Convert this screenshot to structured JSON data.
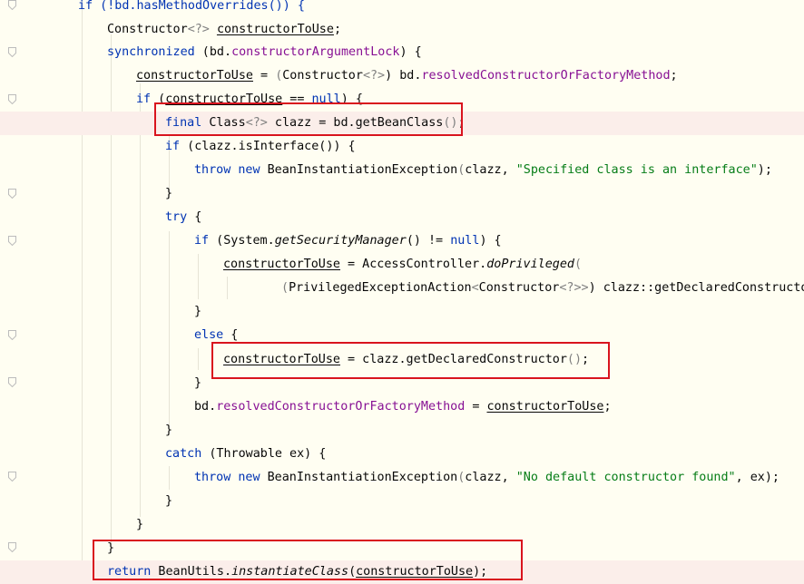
{
  "lines": [
    {
      "tokens": [
        {
          "t": "if (!bd.hasMethodOverrides()) {",
          "c": "kw"
        }
      ]
    },
    {
      "tokens": [
        {
          "t": "Constructor"
        },
        {
          "t": "<?>",
          "c": "gr"
        },
        {
          "t": " "
        },
        {
          "t": "constructorToUse",
          "c": "und"
        },
        {
          "t": ";"
        }
      ]
    },
    {
      "tokens": [
        {
          "t": "synchronized",
          "c": "kw"
        },
        {
          "t": " (bd."
        },
        {
          "t": "constructorArgumentLock",
          "c": "fld"
        },
        {
          "t": ") {"
        }
      ]
    },
    {
      "tokens": [
        {
          "t": "constructorToUse",
          "c": "und"
        },
        {
          "t": " = "
        },
        {
          "t": "(",
          "c": "gr"
        },
        {
          "t": "Constructor"
        },
        {
          "t": "<?>",
          "c": "gr"
        },
        {
          "t": ") bd."
        },
        {
          "t": "resolvedConstructorOrFactoryMethod",
          "c": "fld"
        },
        {
          "t": ";"
        }
      ]
    },
    {
      "tokens": [
        {
          "t": "if",
          "c": "kw"
        },
        {
          "t": " ("
        },
        {
          "t": "constructorToUse",
          "c": "und"
        },
        {
          "t": " == "
        },
        {
          "t": "null",
          "c": "kw"
        },
        {
          "t": ") {"
        }
      ]
    },
    {
      "tokens": [
        {
          "t": "final",
          "c": "kw"
        },
        {
          "t": " Class"
        },
        {
          "t": "<?>",
          "c": "gr"
        },
        {
          "t": " clazz = bd.getBeanClass"
        },
        {
          "t": "()",
          "c": "gr"
        },
        {
          "t": ";"
        }
      ]
    },
    {
      "tokens": [
        {
          "t": "if",
          "c": "kw"
        },
        {
          "t": " (clazz.isInterface()) {"
        }
      ]
    },
    {
      "tokens": [
        {
          "t": "throw new",
          "c": "kw"
        },
        {
          "t": " BeanInstantiationException"
        },
        {
          "t": "(",
          "c": "gr"
        },
        {
          "t": "clazz, "
        },
        {
          "t": "\"Specified class is an interface\"",
          "c": "str"
        },
        {
          "t": ");"
        }
      ]
    },
    {
      "tokens": [
        {
          "t": "}"
        }
      ]
    },
    {
      "tokens": [
        {
          "t": "try",
          "c": "kw"
        },
        {
          "t": " {"
        }
      ]
    },
    {
      "tokens": [
        {
          "t": "if",
          "c": "kw"
        },
        {
          "t": " (System."
        },
        {
          "t": "getSecurityManager",
          "c": "ital"
        },
        {
          "t": "() != "
        },
        {
          "t": "null",
          "c": "kw"
        },
        {
          "t": ") {"
        }
      ]
    },
    {
      "tokens": [
        {
          "t": "constructorToUse",
          "c": "und"
        },
        {
          "t": " = AccessController."
        },
        {
          "t": "doPrivileged",
          "c": "ital"
        },
        {
          "t": "(",
          "c": "gr"
        }
      ]
    },
    {
      "tokens": [
        {
          "t": "(",
          "c": "gr"
        },
        {
          "t": "PrivilegedExceptionAction"
        },
        {
          "t": "<",
          "c": "gr"
        },
        {
          "t": "Constructor"
        },
        {
          "t": "<?>>",
          "c": "gr"
        },
        {
          "t": ") clazz::getDeclaredConstructor"
        }
      ]
    },
    {
      "tokens": [
        {
          "t": "}"
        }
      ]
    },
    {
      "tokens": [
        {
          "t": "else",
          "c": "kw"
        },
        {
          "t": " {"
        }
      ]
    },
    {
      "tokens": [
        {
          "t": "constructorToUse",
          "c": "und"
        },
        {
          "t": " = clazz.getDeclaredConstructor"
        },
        {
          "t": "()",
          "c": "gr"
        },
        {
          "t": ";"
        }
      ]
    },
    {
      "tokens": [
        {
          "t": "}"
        }
      ]
    },
    {
      "tokens": [
        {
          "t": "bd."
        },
        {
          "t": "resolvedConstructorOrFactoryMethod",
          "c": "fld"
        },
        {
          "t": " = "
        },
        {
          "t": "constructorToUse",
          "c": "und"
        },
        {
          "t": ";"
        }
      ]
    },
    {
      "tokens": [
        {
          "t": "}"
        }
      ]
    },
    {
      "tokens": [
        {
          "t": "catch",
          "c": "kw"
        },
        {
          "t": " (Throwable ex) {"
        }
      ]
    },
    {
      "tokens": [
        {
          "t": "throw new",
          "c": "kw"
        },
        {
          "t": " BeanInstantiationException"
        },
        {
          "t": "(",
          "c": "gr"
        },
        {
          "t": "clazz, "
        },
        {
          "t": "\"No default constructor found\"",
          "c": "str"
        },
        {
          "t": ", ex);"
        }
      ]
    },
    {
      "tokens": [
        {
          "t": "}"
        }
      ]
    },
    {
      "tokens": [
        {
          "t": "}"
        }
      ]
    },
    {
      "tokens": [
        {
          "t": "}"
        }
      ]
    },
    {
      "tokens": [
        {
          "t": "return",
          "c": "kw"
        },
        {
          "t": " BeanUtils."
        },
        {
          "t": "instantiateClass",
          "c": "ital"
        },
        {
          "t": "("
        },
        {
          "t": "constructorToUse",
          "c": "und"
        },
        {
          "t": ");"
        }
      ]
    }
  ]
}
